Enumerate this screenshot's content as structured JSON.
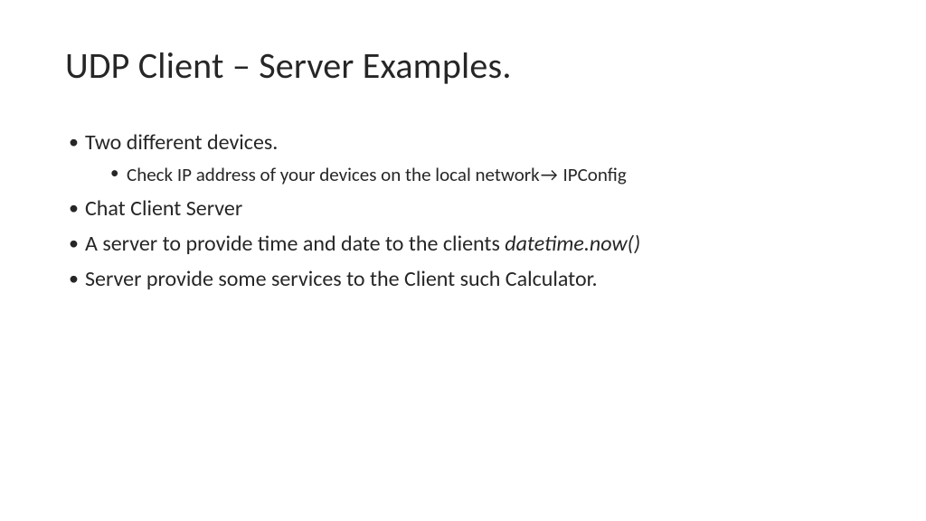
{
  "slide": {
    "title": "UDP Client – Server Examples.",
    "bullets": {
      "b0": "Two different devices.",
      "b0_sub0_pre": "Check IP address of your devices on the local network",
      "b0_sub0_arrow": "→",
      "b0_sub0_post": " IPConfig",
      "b1": "Chat Client Server",
      "b2_pre": "A server to provide time and date to the clients ",
      "b2_code": "datetime.now()",
      "b3": "Server provide some services to the Client such Calculator."
    }
  }
}
